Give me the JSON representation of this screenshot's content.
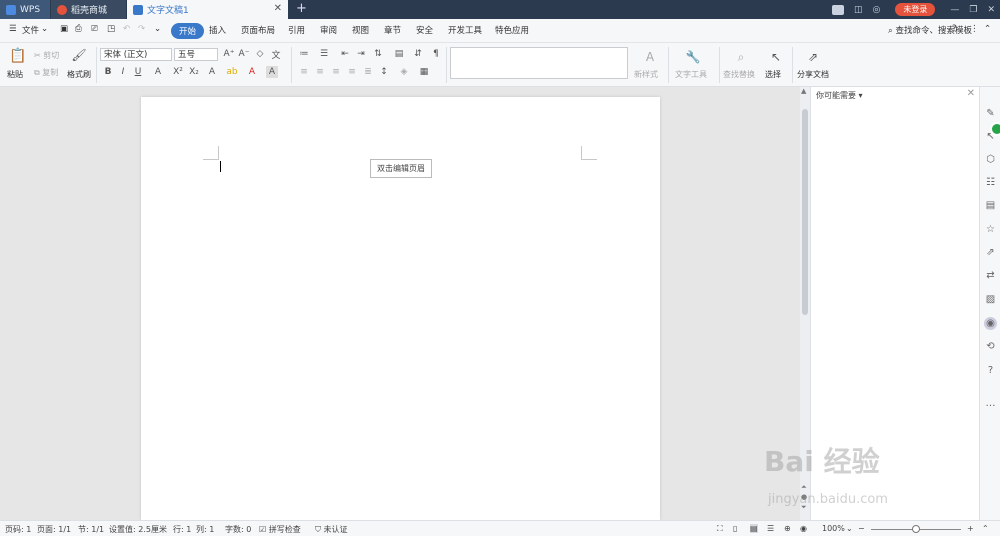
{
  "tabs": {
    "wps": "WPS",
    "shop": "稻壳商城",
    "doc": "文字文稿1",
    "close": "✕",
    "new": "+"
  },
  "topbar": {
    "page_badge": "1",
    "login": "未登录"
  },
  "menu": {
    "file": "文件",
    "items": [
      "开始",
      "插入",
      "页面布局",
      "引用",
      "审阅",
      "视图",
      "章节",
      "安全",
      "开发工具",
      "特色应用"
    ],
    "search": "查找命令、搜索模板"
  },
  "toolbar": {
    "paste": "粘贴",
    "cut": "剪切",
    "copy": "复制",
    "format_painter": "格式刷",
    "font_name": "宋体 (正文)",
    "font_size": "五号",
    "new_style": "新样式",
    "text_tools": "文字工具",
    "find_replace": "查找替换",
    "select": "选择",
    "share": "分享文档"
  },
  "document": {
    "header_hint": "双击编辑页眉"
  },
  "sidepane": {
    "title": "你可能需要"
  },
  "status": {
    "page_no": "页码: 1",
    "pages": "页面: 1/1",
    "section": "节: 1/1",
    "setting": "设置值: 2.5厘米",
    "row": "行: 1",
    "col": "列: 1",
    "words": "字数: 0",
    "spell": "拼写检查",
    "cert": "未认证",
    "zoom": "100%"
  },
  "zoom_level": 0.5,
  "watermark": {
    "text": "Bai 经验",
    "url": "jingyan.baidu.com"
  },
  "colors": {
    "accent": "#3a78c9",
    "titlebar": "#2b3a4e",
    "login": "#e5533c",
    "green": "#27a44a"
  }
}
